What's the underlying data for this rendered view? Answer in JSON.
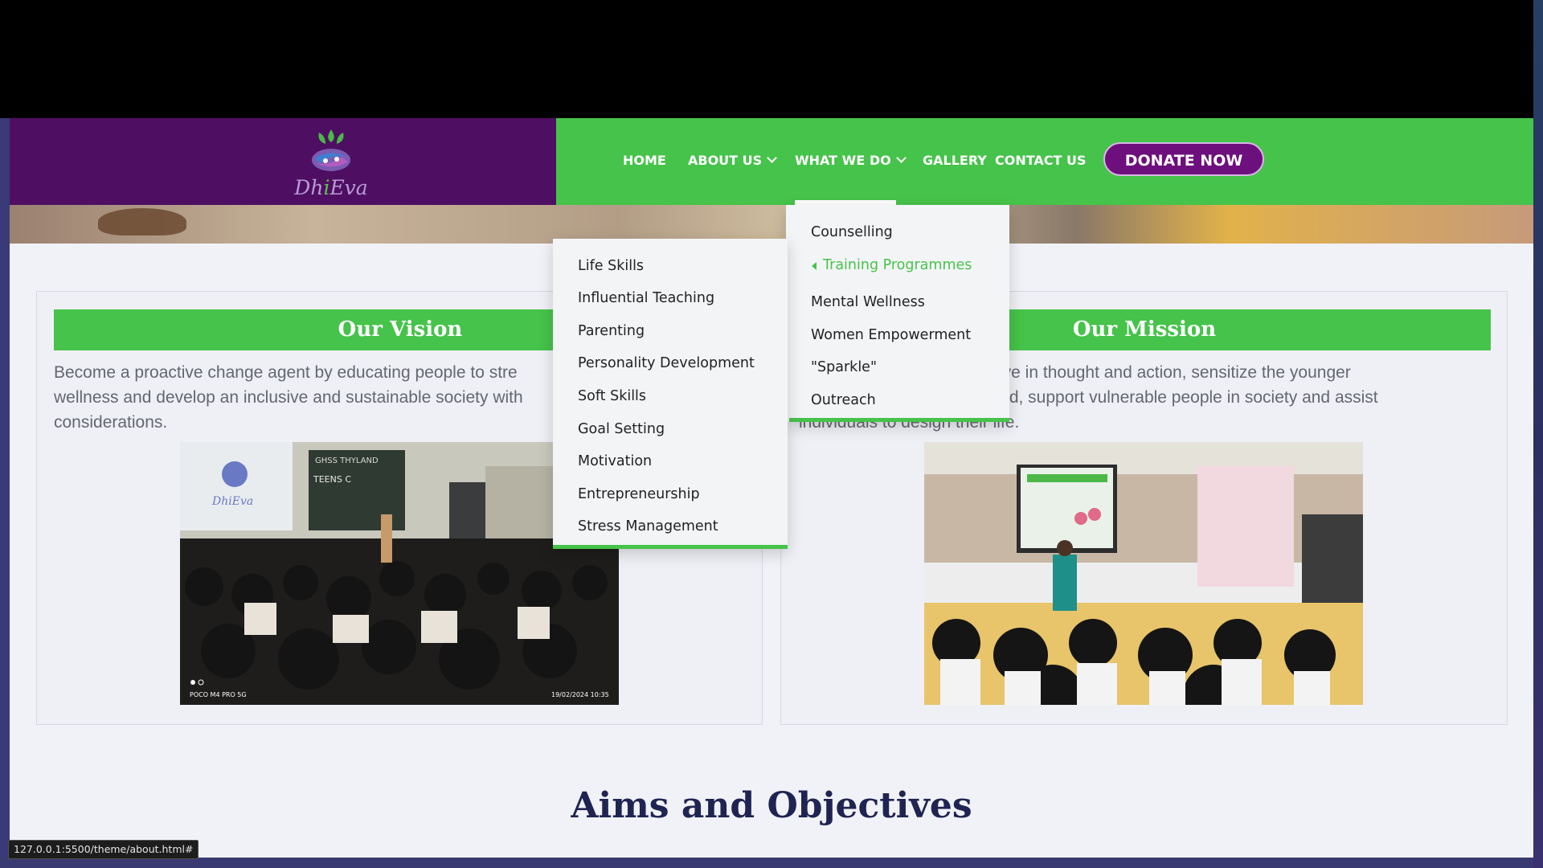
{
  "brand": {
    "logo_text": "Dh",
    "logo_text_accent": "i",
    "logo_text_end": "Eva",
    "purple": "#4e0f63",
    "green": "#46c34a"
  },
  "nav": {
    "items": [
      {
        "label": "HOME"
      },
      {
        "label": "ABOUT US"
      },
      {
        "label": "WHAT WE DO"
      },
      {
        "label": "GALLERY"
      },
      {
        "label": "CONTACT US"
      }
    ],
    "donate_label": "DONATE NOW"
  },
  "vision": {
    "title": "Our Vision",
    "lines": [
      "Become a proactive change agent by educating people to stre",
      "wellness and develop an inclusive and sustainable society with",
      "considerations."
    ],
    "photo_overlay": {
      "camera": "POCO M4 PRO 5G",
      "timestamp": "19/02/2024  10:35",
      "logo_text": "DhiEva",
      "board_text": "GHSS THYLAND",
      "banner_text": "TEENS C"
    }
  },
  "mission": {
    "title": "Our Mission",
    "lines": [
      "ssive in thought and action, sensitize the younger",
      "mind, support vulnerable people in society and assist",
      "individuals to design their life."
    ]
  },
  "what_we_do_menu": {
    "items": [
      {
        "label": "Counselling"
      },
      {
        "label": "Training Programmes"
      },
      {
        "label": "Mental Wellness"
      },
      {
        "label": "Women Empowerment"
      },
      {
        "label": "\"Sparkle\""
      },
      {
        "label": "Outreach"
      }
    ]
  },
  "training_submenu": {
    "items": [
      {
        "label": "Life Skills"
      },
      {
        "label": "Influential Teaching"
      },
      {
        "label": "Parenting"
      },
      {
        "label": "Personality Development"
      },
      {
        "label": "Soft Skills"
      },
      {
        "label": "Goal Setting"
      },
      {
        "label": "Motivation"
      },
      {
        "label": "Entrepreneurship"
      },
      {
        "label": "Stress Management"
      }
    ]
  },
  "aims": {
    "title": "Aims and Objectives"
  },
  "status_bar": {
    "url": "127.0.0.1:5500/theme/about.html#"
  }
}
